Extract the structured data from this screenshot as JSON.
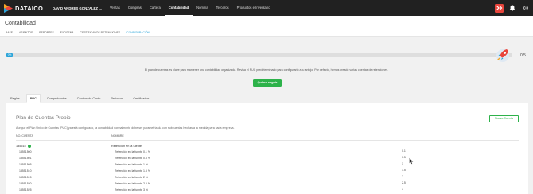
{
  "app": {
    "brand": "DATAICO",
    "company": "DAVID ANDRES GONZALEZ ...",
    "nav": [
      "Ventas",
      "Compras",
      "Cartera",
      "Contabilidad",
      "Nómina",
      "Terceros",
      "Productos e Inventario"
    ],
    "active_nav": "Contabilidad",
    "colors": {
      "topbar": "#212121",
      "accent": "#29a3d8",
      "primary_button": "#2db24a",
      "alert_button": "#e8453c"
    }
  },
  "page": {
    "title": "Contabilidad",
    "subnav": [
      "BASE",
      "ASIENTOS",
      "REPORTES",
      "EXOGENA",
      "CERTIFICADOS RETENCIONES",
      "CONFIGURACIÓN"
    ],
    "active_subnav": "CONFIGURACIÓN"
  },
  "progress": {
    "done": 0,
    "total": 5,
    "badge": "0%",
    "count_label": "0/5",
    "message": "El plan de cuentas es clave para mantener una contabilidad organizada. Revisa el PUC predeterminado para configurarlo a tu antojo. Por defecto, hemos creado varias cuentas de retenciones.",
    "button_label": "Quiero seguir"
  },
  "tabs": [
    "Reglas",
    "PUC",
    "Comprobantes",
    "Centros de Costo",
    "Periodos",
    "Certificados"
  ],
  "active_tab": "PUC",
  "puc": {
    "title": "Plan de Cuentas Propio",
    "new_button": "Nueva Cuenta",
    "description": "Aunque el Plan Único de Cuentas (PUC) ya está configurado, la contabilidad normalmente debe ser parametrizada con subcuentas hechas a la medida para cada empresa.",
    "columns": {
      "code": "NO. CUENTA",
      "name": "NOMBRE"
    },
    "parent": {
      "code": "135515",
      "name": "Retención en la fuente"
    },
    "rows": [
      {
        "code": "13551500",
        "name": "Retención en la fuente 0.1 %",
        "value": "0.1"
      },
      {
        "code": "13551501",
        "name": "Retención en la fuente 0.5 %",
        "value": "0.5"
      },
      {
        "code": "13551505",
        "name": "Retención en la fuente 1 %",
        "value": "1"
      },
      {
        "code": "13551510",
        "name": "Retención en la fuente 1.5 %",
        "value": "1.5"
      },
      {
        "code": "13551515",
        "name": "Retención en la fuente 2 %",
        "value": "2"
      },
      {
        "code": "13551520",
        "name": "Retención en la fuente 2.5 %",
        "value": "2.5"
      },
      {
        "code": "13551525",
        "name": "Retención en la fuente 3 %",
        "value": "3"
      }
    ]
  }
}
